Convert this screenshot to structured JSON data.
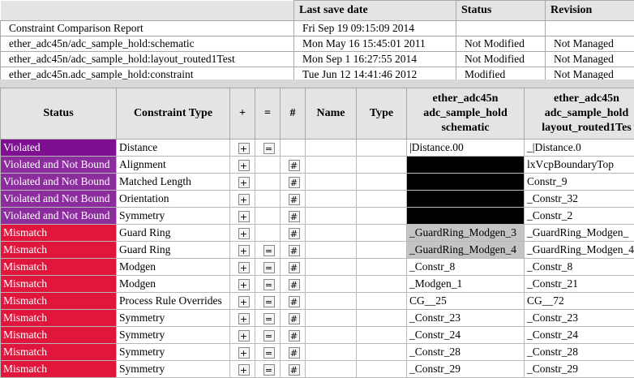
{
  "summary": {
    "headers": {
      "last_save": "Last save date",
      "status": "Status",
      "revision": "Revision"
    },
    "rows": [
      {
        "name": "Constraint Comparison Report",
        "date": "Fri Sep 19 09:15:09 2014",
        "status": "",
        "revision": ""
      },
      {
        "name": "ether_adc45n/adc_sample_hold:schematic",
        "date": "Mon May 16 15:45:01 2011",
        "status": "Not Modified",
        "revision": "Not Managed"
      },
      {
        "name": "ether_adc45n/adc_sample_hold:layout_routed1Test",
        "date": "Mon Sep 1 16:27:55 2014",
        "status": "Not Modified",
        "revision": "Not Managed"
      },
      {
        "name": "ether_adc45n.adc_sample_hold:constraint",
        "date": "Tue Jun 12 14:41:46 2012",
        "status": "Modified",
        "revision": "Not Managed"
      }
    ]
  },
  "main": {
    "headers": {
      "status": "Status",
      "type": "Constraint Type",
      "plus": "+",
      "eq": "=",
      "hash": "#",
      "name": "Name",
      "ctype": "Type",
      "schematic_1": "ether_adc45n",
      "schematic_2": "adc_sample_hold",
      "schematic_3": "schematic",
      "layout_1": "ether_adc45n",
      "layout_2": "adc_sample_hold",
      "layout_3": "layout_routed1Tes"
    },
    "buttons": {
      "plus": "+",
      "eq": "=",
      "hash": "#"
    },
    "rows": [
      {
        "status": "Violated",
        "type": "Distance",
        "schematic": "|Distance.00",
        "layout": "_|Distance.0"
      },
      {
        "status": "Violated and Not Bound",
        "type": "Alignment",
        "schematic": "",
        "layout": "lxVcpBoundaryTop"
      },
      {
        "status": "Violated and Not Bound",
        "type": "Matched Length",
        "schematic": "",
        "layout": "Constr_9"
      },
      {
        "status": "Violated and Not Bound",
        "type": "Orientation",
        "schematic": "",
        "layout": "_Constr_32"
      },
      {
        "status": "Violated and Not Bound",
        "type": "Symmetry",
        "schematic": "",
        "layout": "_Constr_2"
      },
      {
        "status": "Mismatch",
        "type": "Guard Ring",
        "schematic": "_GuardRing_Modgen_3",
        "layout": "_GuardRing_Modgen_"
      },
      {
        "status": "Mismatch",
        "type": "Guard Ring",
        "schematic": "_GuardRing_Modgen_4",
        "layout": "_GuardRing_Modgen_4"
      },
      {
        "status": "Mismatch",
        "type": "Modgen",
        "schematic": "_Constr_8",
        "layout": "_Constr_8"
      },
      {
        "status": "Mismatch",
        "type": "Modgen",
        "schematic": "_Modgen_1",
        "layout": "_Constr_21"
      },
      {
        "status": "Mismatch",
        "type": "Process Rule Overrides",
        "schematic": "CG__25",
        "layout": "CG__72"
      },
      {
        "status": "Mismatch",
        "type": "Symmetry",
        "schematic": "_Constr_23",
        "layout": "_Constr_23"
      },
      {
        "status": "Mismatch",
        "type": "Symmetry",
        "schematic": "_Constr_24",
        "layout": "_Constr_24"
      },
      {
        "status": "Mismatch",
        "type": "Symmetry",
        "schematic": "_Constr_28",
        "layout": "_Constr_28"
      },
      {
        "status": "Mismatch",
        "type": "Symmetry",
        "schematic": "_Constr_29",
        "layout": "_Constr_29"
      }
    ]
  },
  "colors": {
    "violated": "#7e0f93",
    "violated_not_bound": "#8c2d9e",
    "mismatch": "#e0163d",
    "header_bg": "#e4e4e4"
  }
}
